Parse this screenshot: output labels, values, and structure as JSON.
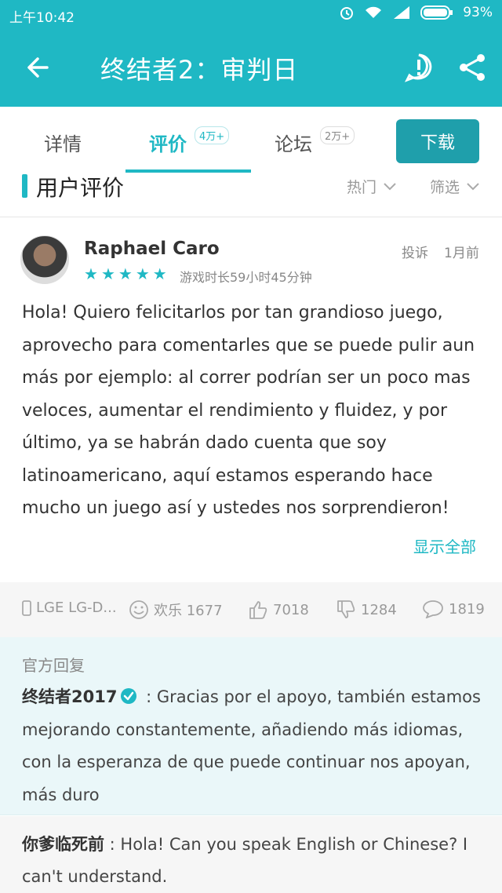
{
  "status_bar": {
    "time": "上午10:42",
    "battery": "93%"
  },
  "app_bar": {
    "title": "终结者2：审判日"
  },
  "tabs": [
    {
      "label": "详情",
      "badge": ""
    },
    {
      "label": "评价",
      "badge": "4万+"
    },
    {
      "label": "论坛",
      "badge": "2万+"
    }
  ],
  "download_label": "下载",
  "section": {
    "title": "用户评价",
    "sort_label": "热门",
    "filter_label": "筛选"
  },
  "review": {
    "user": "Raphael Caro",
    "rating": 5,
    "playtime": "游戏时长59小时45分钟",
    "report_label": "投诉",
    "time_ago": "1月前",
    "text": "Hola! Quiero felicitarlos por tan grandioso juego, aprovecho para comentarles que se puede pulir aun más por ejemplo: al correr podrían ser un poco mas veloces, aumentar el rendimiento y fluidez, y por último, ya se habrán dado cuenta que soy latinoamericano, aquí estamos esperando hace mucho un juego así y ustedes nos sorprendieron!",
    "show_all": "显示全部",
    "device": "LGE LG-D...",
    "fun_label": "欢乐 1677",
    "likes": "7018",
    "dislikes": "1284",
    "comments": "1819"
  },
  "official_reply": {
    "label": "官方回复",
    "author": "终结者2017",
    "text": " : Gracias por el apoyo, también estamos mejorando constantemente, añadiendo más idiomas, con la esperanza de que puede continuar nos apoyan, más duro"
  },
  "user_reply": {
    "author": "你爹临死前",
    "text": " : Hola! Can you speak English or Chinese? I can't understand."
  },
  "colors": {
    "accent": "#1fb8c4",
    "download": "#1f9fab"
  }
}
